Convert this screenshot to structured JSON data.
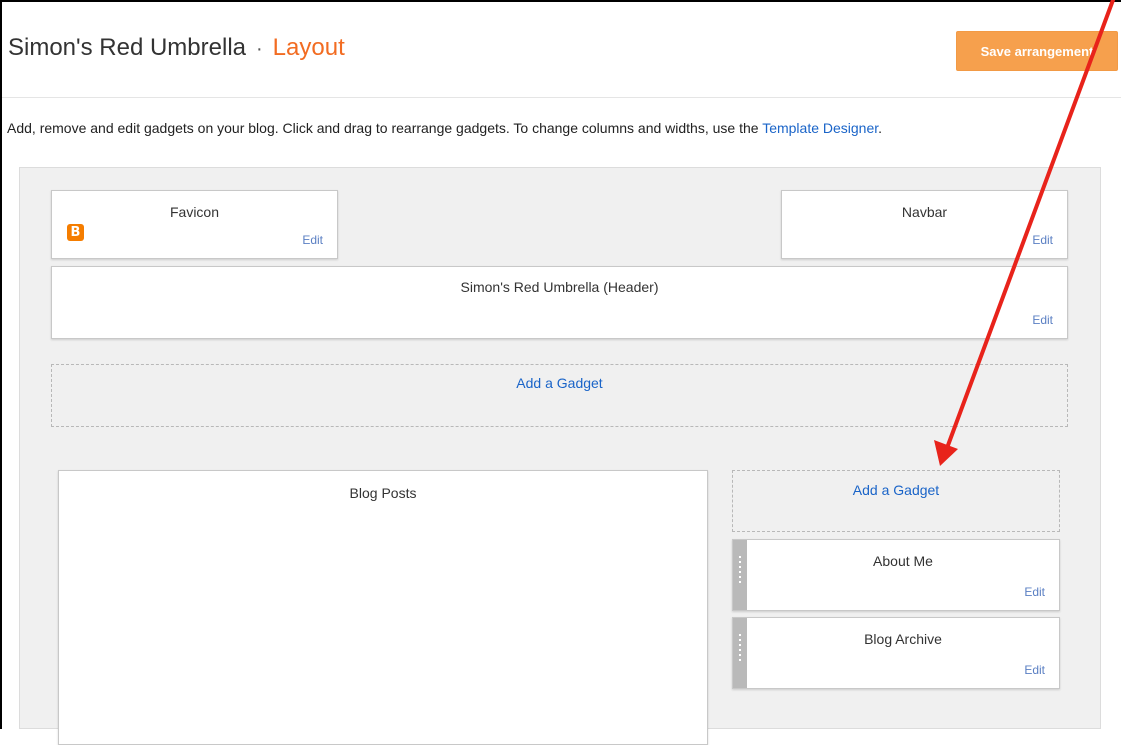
{
  "header": {
    "blog_name": "Simon's Red Umbrella",
    "separator": "·",
    "section": "Layout",
    "save_label": "Save arrangement"
  },
  "description": {
    "text": "Add, remove and edit gadgets on your blog. Click and drag to rearrange gadgets. To change columns and widths, use the ",
    "link": "Template Designer",
    "end": "."
  },
  "gadgets": {
    "favicon": {
      "title": "Favicon",
      "edit": "Edit"
    },
    "navbar": {
      "title": "Navbar",
      "edit": "Edit"
    },
    "header": {
      "title": "Simon's Red Umbrella (Header)",
      "edit": "Edit"
    },
    "add_gadget_main": "Add a Gadget",
    "blog_posts": {
      "title": "Blog Posts"
    },
    "add_gadget_sidebar": "Add a Gadget",
    "about_me": {
      "title": "About Me",
      "edit": "Edit"
    },
    "blog_archive": {
      "title": "Blog Archive",
      "edit": "Edit"
    }
  },
  "icons": {
    "favicon": "blogger-icon",
    "annotation": "red-arrow"
  },
  "colors": {
    "accent": "#f26c22",
    "save_button": "#f6a04d",
    "link": "#1a64c8",
    "annotation_arrow": "#e8231b"
  }
}
